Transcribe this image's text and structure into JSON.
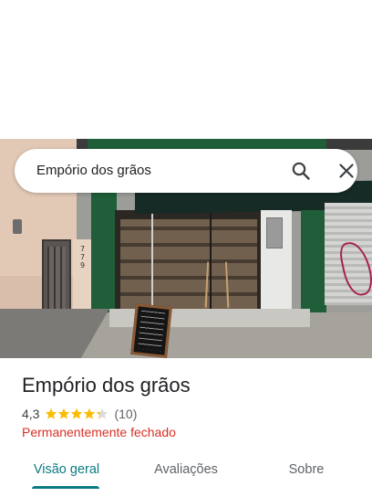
{
  "search": {
    "query": "Empório dos grãos",
    "search_icon": "search-icon",
    "close_icon": "close-icon"
  },
  "photo": {
    "address_number": "779"
  },
  "place": {
    "name": "Empório dos grãos",
    "rating": "4,3",
    "rating_value": 4.3,
    "stars_max": 5,
    "review_count": "(10)",
    "status": "Permanentemente fechado"
  },
  "tabs": [
    {
      "label": "Visão geral",
      "active": true
    },
    {
      "label": "Avaliações",
      "active": false
    },
    {
      "label": "Sobre",
      "active": false
    }
  ],
  "colors": {
    "accent": "#0b7b82",
    "star": "#fbbc04",
    "star_empty": "#dadce0",
    "closed_status": "#d93025"
  }
}
